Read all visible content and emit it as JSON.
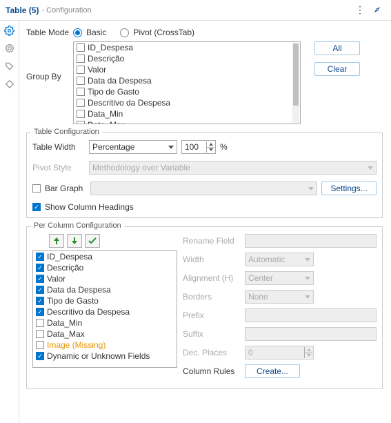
{
  "header": {
    "title": "Table (5)",
    "subtitle": "- Configuration"
  },
  "tableMode": {
    "label": "Table Mode",
    "basic": "Basic",
    "pivot": "Pivot (CrossTab)"
  },
  "groupBy": {
    "label": "Group By",
    "items": [
      "ID_Despesa",
      "Descrição",
      "Valor",
      "Data da Despesa",
      "Tipo de Gasto",
      "Descritivo da Despesa",
      "Data_Min",
      "Data_Max"
    ]
  },
  "buttons": {
    "all": "All",
    "clear": "Clear",
    "settings": "Settings...",
    "create": "Create..."
  },
  "tableConfig": {
    "legend": "Table Configuration",
    "widthLabel": "Table Width",
    "widthMode": "Percentage",
    "widthValue": "100",
    "pct": "%",
    "pivotStyleLabel": "Pivot Style",
    "pivotStyleValue": "Methodology over Variable",
    "barGraphLabel": "Bar Graph",
    "showHeadings": "Show Column Headings"
  },
  "perColumn": {
    "legend": "Per Column Configuration",
    "items": [
      {
        "label": "ID_Despesa",
        "checked": true
      },
      {
        "label": "Descrição",
        "checked": true
      },
      {
        "label": "Valor",
        "checked": true
      },
      {
        "label": "Data da Despesa",
        "checked": true
      },
      {
        "label": "Tipo de Gasto",
        "checked": true
      },
      {
        "label": "Descritivo da Despesa",
        "checked": true
      },
      {
        "label": "Data_Min",
        "checked": false
      },
      {
        "label": "Data_Max",
        "checked": false
      },
      {
        "label": "Image (Missing)",
        "checked": false,
        "missing": true
      },
      {
        "label": "Dynamic or Unknown Fields",
        "checked": true
      }
    ],
    "fields": {
      "rename": "Rename Field",
      "width": "Width",
      "widthVal": "Automatic",
      "align": "Alignment (H)",
      "alignVal": "Center",
      "borders": "Borders",
      "bordersVal": "None",
      "prefix": "Prefix",
      "suffix": "Suffix",
      "dec": "Dec. Places",
      "decVal": "0",
      "rules": "Column Rules"
    }
  }
}
